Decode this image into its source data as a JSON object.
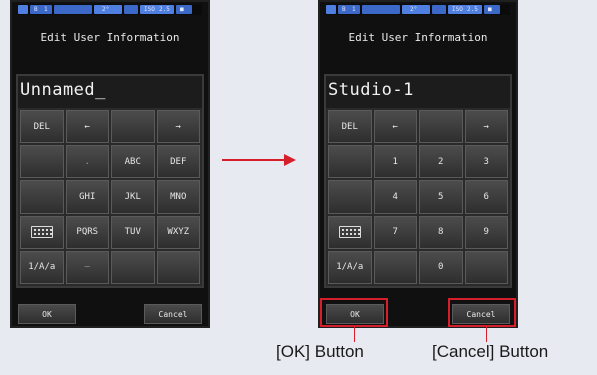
{
  "screen": {
    "title": "Edit User Information"
  },
  "status_bar": {
    "items": [
      "B",
      "1",
      "2°",
      "ISO",
      "2.5",
      "■"
    ]
  },
  "before": {
    "entry_value": "Unnamed_",
    "keys": [
      {
        "label": "DEL",
        "dim": false,
        "icon": ""
      },
      {
        "label": "←",
        "dim": false,
        "icon": ""
      },
      {
        "label": "",
        "dim": false,
        "icon": ""
      },
      {
        "label": "→",
        "dim": false,
        "icon": ""
      },
      {
        "label": "",
        "dim": false,
        "icon": ""
      },
      {
        "label": ".",
        "dim": true,
        "icon": ""
      },
      {
        "label": "ABC",
        "dim": false,
        "icon": ""
      },
      {
        "label": "DEF",
        "dim": false,
        "icon": ""
      },
      {
        "label": "",
        "dim": false,
        "icon": ""
      },
      {
        "label": "GHI",
        "dim": false,
        "icon": ""
      },
      {
        "label": "JKL",
        "dim": false,
        "icon": ""
      },
      {
        "label": "MNO",
        "dim": false,
        "icon": ""
      },
      {
        "label": "",
        "dim": false,
        "icon": "keyboard-icon"
      },
      {
        "label": "PQRS",
        "dim": false,
        "icon": ""
      },
      {
        "label": "TUV",
        "dim": false,
        "icon": ""
      },
      {
        "label": "WXYZ",
        "dim": false,
        "icon": ""
      },
      {
        "label": "1/A/a",
        "dim": false,
        "icon": ""
      },
      {
        "label": "—",
        "dim": true,
        "icon": ""
      },
      {
        "label": "",
        "dim": false,
        "icon": ""
      },
      {
        "label": "",
        "dim": false,
        "icon": ""
      }
    ]
  },
  "after": {
    "entry_value": "Studio-1",
    "keys": [
      {
        "label": "DEL",
        "dim": false,
        "icon": ""
      },
      {
        "label": "←",
        "dim": false,
        "icon": ""
      },
      {
        "label": "",
        "dim": false,
        "icon": ""
      },
      {
        "label": "→",
        "dim": false,
        "icon": ""
      },
      {
        "label": "",
        "dim": false,
        "icon": ""
      },
      {
        "label": "1",
        "dim": false,
        "icon": ""
      },
      {
        "label": "2",
        "dim": false,
        "icon": ""
      },
      {
        "label": "3",
        "dim": false,
        "icon": ""
      },
      {
        "label": "",
        "dim": false,
        "icon": ""
      },
      {
        "label": "4",
        "dim": false,
        "icon": ""
      },
      {
        "label": "5",
        "dim": false,
        "icon": ""
      },
      {
        "label": "6",
        "dim": false,
        "icon": ""
      },
      {
        "label": "",
        "dim": false,
        "icon": "keyboard-icon"
      },
      {
        "label": "7",
        "dim": false,
        "icon": ""
      },
      {
        "label": "8",
        "dim": false,
        "icon": ""
      },
      {
        "label": "9",
        "dim": false,
        "icon": ""
      },
      {
        "label": "1/A/a",
        "dim": false,
        "icon": ""
      },
      {
        "label": "",
        "dim": false,
        "icon": ""
      },
      {
        "label": "0",
        "dim": false,
        "icon": ""
      },
      {
        "label": "",
        "dim": false,
        "icon": ""
      }
    ]
  },
  "softkeys": {
    "ok": "OK",
    "cancel": "Cancel"
  },
  "callouts": {
    "ok": "[OK] Button",
    "cancel": "[Cancel] Button"
  },
  "colors": {
    "highlight": "#d61f2a",
    "arrow": "#d61f2a",
    "background": "#e8eaf2"
  }
}
